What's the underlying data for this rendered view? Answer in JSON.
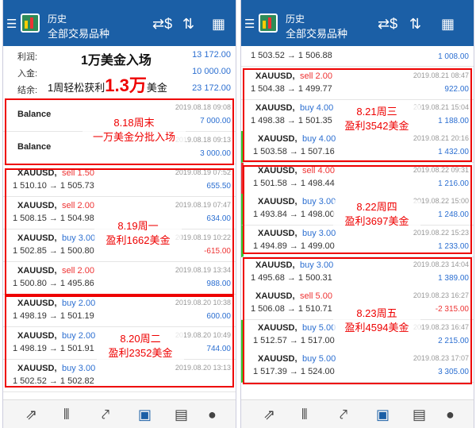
{
  "header": {
    "line1": "历史",
    "line2": "全部交易品种"
  },
  "summary": {
    "profit_label": "利润:",
    "profit_value": "13 172.00",
    "deposit_label": "入金:",
    "deposit_value": "10 000.00",
    "balance_label": "结余:",
    "balance_value": "23 172.00"
  },
  "banner": {
    "line1": "1万美金入场",
    "line2a": "1周轻松获利",
    "line2b": "1.3万",
    "line2c": "美金"
  },
  "left_rows": [
    {
      "sym": "Balance",
      "act": "",
      "act_type": "",
      "prices": "",
      "date": "2019.08.18 09:08",
      "value": "7 000.00"
    },
    {
      "sym": "Balance",
      "act": "",
      "act_type": "",
      "prices": "",
      "date": "2019.08.18 09:13",
      "value": "3 000.00"
    },
    {
      "sym": "XAUUSD,",
      "act": "sell 1.50",
      "act_type": "sell",
      "prices": "1 510.10 → 1 505.73",
      "date": "2019.08.19 07:52",
      "value": "655.50"
    },
    {
      "sym": "XAUUSD,",
      "act": "sell 2.00",
      "act_type": "sell",
      "prices": "1 508.15 → 1 504.98",
      "date": "2019.08.19 07:47",
      "value": "634.00"
    },
    {
      "sym": "XAUUSD,",
      "act": "buy 3.00",
      "act_type": "buy",
      "prices": "1 502.85 → 1 500.80",
      "date": "2019.08.19 10:22",
      "value": "-615.00"
    },
    {
      "sym": "XAUUSD,",
      "act": "sell 2.00",
      "act_type": "sell",
      "prices": "1 500.80 → 1 495.86",
      "date": "2019.08.19 13:34",
      "value": "988.00"
    },
    {
      "sym": "XAUUSD,",
      "act": "buy 2.00",
      "act_type": "buy",
      "prices": "1 498.19 → 1 501.19",
      "date": "2019.08.20 10:38",
      "value": "600.00"
    },
    {
      "sym": "XAUUSD,",
      "act": "buy 2.00",
      "act_type": "buy",
      "prices": "1 498.19 → 1 501.91",
      "date": "2019.08.20 10:49",
      "value": "744.00"
    },
    {
      "sym": "XAUUSD,",
      "act": "buy 3.00",
      "act_type": "buy",
      "prices": "1 502.52 → 1 502.82",
      "date": "2019.08.20 13:13",
      "value": ""
    }
  ],
  "right_top": {
    "prices": "1 503.52 → 1 506.88",
    "value": "1 008.00"
  },
  "right_rows": [
    {
      "sym": "XAUUSD,",
      "act": "sell 2.00",
      "act_type": "sell",
      "prices": "1 504.38 → 1 499.77",
      "date": "2019.08.21 08:47",
      "value": "922.00"
    },
    {
      "sym": "XAUUSD,",
      "act": "buy 4.00",
      "act_type": "buy",
      "prices": "1 498.38 → 1 501.35",
      "date": "2019.08.21 15:04",
      "value": "1 188.00"
    },
    {
      "sym": "XAUUSD,",
      "act": "buy 4.00",
      "act_type": "buy",
      "prices": "1 503.58 → 1 507.16",
      "date": "2019.08.21 20:16",
      "value": "1 432.00"
    },
    {
      "sym": "XAUUSD,",
      "act": "sell 4.00",
      "act_type": "sell",
      "prices": "1 501.58 → 1 498.44",
      "date": "2019.08.22 09:31",
      "value": "1 216.00"
    },
    {
      "sym": "XAUUSD,",
      "act": "buy 3.00",
      "act_type": "buy",
      "prices": "1 493.84 → 1 498.00",
      "date": "2019.08.22 15:00",
      "value": "1 248.00"
    },
    {
      "sym": "XAUUSD,",
      "act": "buy 3.00",
      "act_type": "buy",
      "prices": "1 494.89 → 1 499.00",
      "date": "2019.08.22 15:23",
      "value": "1 233.00"
    },
    {
      "sym": "XAUUSD,",
      "act": "buy 3.00",
      "act_type": "buy",
      "prices": "1 495.68 → 1 500.31",
      "date": "2019.08.23 14:04",
      "value": "1 389.00"
    },
    {
      "sym": "XAUUSD,",
      "act": "sell 5.00",
      "act_type": "sell",
      "prices": "1 506.08 → 1 510.71",
      "date": "2019.08.23 16:27",
      "value": "-2 315.00"
    },
    {
      "sym": "XAUUSD,",
      "act": "buy 5.00",
      "act_type": "buy",
      "prices": "1 512.57 → 1 517.00",
      "date": "2019.08.23 16:47",
      "value": "2 215.00"
    },
    {
      "sym": "XAUUSD,",
      "act": "buy 5.00",
      "act_type": "buy",
      "prices": "1 517.39 → 1 524.00",
      "date": "2019.08.23 17:07",
      "value": "3 305.00"
    }
  ],
  "notes": {
    "n818": [
      "8.18周末",
      "一万美金分批入场"
    ],
    "n819": [
      "8.19周一",
      "盈利1662美金"
    ],
    "n820": [
      "8.20周二",
      "盈利2352美金"
    ],
    "n821": [
      "8.21周三",
      "盈利3542美金"
    ],
    "n822": [
      "8.22周四",
      "盈利3697美金"
    ],
    "n823": [
      "8.23周五",
      "盈利4594美金"
    ]
  },
  "icons": {
    "header": [
      "dollar-sync-icon",
      "sort-icon",
      "calendar-icon"
    ],
    "bottom": [
      "trade-icon",
      "chart-candles-icon",
      "trend-icon",
      "inbox-icon",
      "news-icon",
      "chat-icon"
    ]
  },
  "colors": {
    "header": "#1b5fa6",
    "sell": "#e33",
    "buy": "#2c6fd1",
    "highlight": "#e00"
  }
}
